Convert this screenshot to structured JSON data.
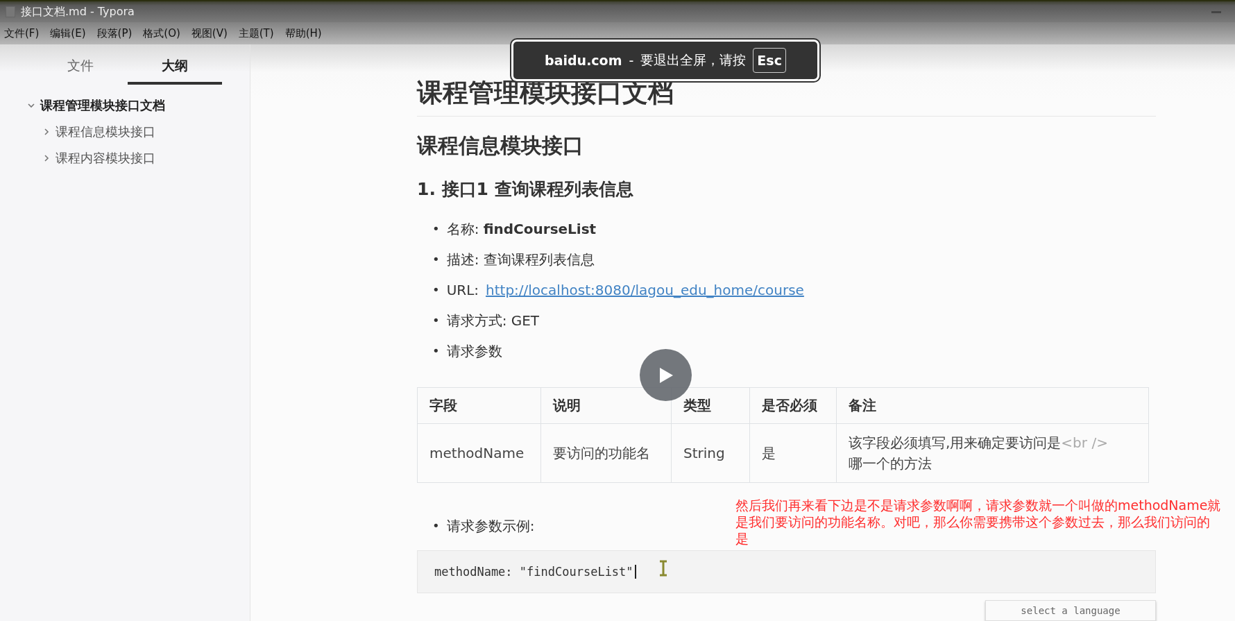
{
  "window": {
    "title": "接口文档.md - Typora"
  },
  "menu": [
    "文件(F)",
    "编辑(E)",
    "段落(P)",
    "格式(O)",
    "视图(V)",
    "主题(T)",
    "帮助(H)"
  ],
  "sidebar": {
    "tabs": [
      {
        "label": "文件",
        "selected": false
      },
      {
        "label": "大纲",
        "selected": true
      }
    ],
    "outline": [
      {
        "label": "课程管理模块接口文档",
        "expanded": true,
        "children": [
          {
            "label": "课程信息模块接口",
            "expanded": false
          },
          {
            "label": "课程内容模块接口",
            "expanded": false
          }
        ]
      }
    ]
  },
  "document": {
    "h1": "课程管理模块接口文档",
    "h2": "课程信息模块接口",
    "h3": "1. 接口1 查询课程列表信息",
    "bullets": [
      {
        "kind": "text",
        "marker": "•",
        "text": "名称:  **findCourseList**"
      },
      {
        "kind": "text",
        "marker": "•",
        "text": "描述:  查询课程列表信息"
      },
      {
        "kind": "link",
        "marker": "•",
        "label": "URL:",
        "link": "http://localhost:8080/lagou_edu_home/course"
      },
      {
        "kind": "text",
        "marker": "•",
        "text": "请求方式: GET"
      },
      {
        "kind": "text",
        "marker": "•",
        "text": "请求参数"
      }
    ],
    "table": {
      "columns": [
        "字段",
        "说明",
        "类型",
        "是否必须",
        "备注"
      ],
      "rows": [
        [
          [
            {
              "text": "methodName",
              "muted": false
            }
          ],
          [
            {
              "text": "要访问的功能名",
              "muted": false
            }
          ],
          [
            {
              "text": "String",
              "muted": false
            }
          ],
          [
            {
              "text": "是",
              "muted": false
            }
          ],
          [
            {
              "text": "该字段必须填写,用来确定要访问是",
              "muted": false
            },
            {
              "text": "<br />",
              "muted": true
            },
            {
              "text": "哪一个的方法",
              "muted": false
            }
          ]
        ]
      ]
    },
    "example_bullet": {
      "marker": "•",
      "text": "请求参数示例:"
    },
    "code": "methodName: \"findCourseList\"",
    "language_select": {
      "placeholder": "select a language"
    }
  },
  "toast": {
    "site": "baidu.com",
    "separator": "-",
    "message": "要退出全屏，请按",
    "key": "Esc"
  },
  "subtitle": "然后我们再来看下边是不是请求参数啊啊，请求参数就一个叫做的methodName就是我们要访问的功能名称。对吧，那么你需要携带这个参数过去，那么我们访问的是"
}
